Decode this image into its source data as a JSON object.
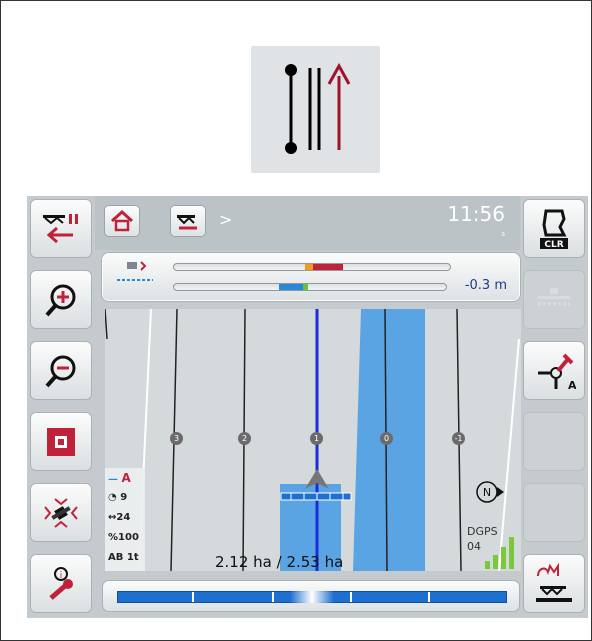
{
  "feature_icon": {
    "name": "parallel-tracks-icon"
  },
  "breadcrumb": {
    "separator": ">"
  },
  "status": {
    "time": "11:56",
    "time_sub": "s"
  },
  "left_buttons": [
    {
      "name": "pause-tracking-button",
      "icon": "implement-pause-icon"
    },
    {
      "name": "zoom-in-button",
      "icon": "zoom-in-icon"
    },
    {
      "name": "zoom-out-button",
      "icon": "zoom-out-icon"
    },
    {
      "name": "stop-button",
      "icon": "stop-square-icon"
    },
    {
      "name": "satellite-button",
      "icon": "satellite-icon"
    },
    {
      "name": "settings-button",
      "icon": "wrench-icon"
    }
  ],
  "right_buttons": [
    {
      "name": "clear-field-button",
      "icon": "clr-field-icon",
      "label": "CLR"
    },
    {
      "name": "boom-button",
      "icon": "boom-icon"
    },
    {
      "name": "set-point-a-button",
      "icon": "pin-a-icon",
      "label": "A"
    },
    {
      "name": "empty-button-1"
    },
    {
      "name": "empty-button-2"
    },
    {
      "name": "manual-section-button",
      "icon": "hand-implement-icon"
    }
  ],
  "lightbar": {
    "offset": "-0.3 m"
  },
  "info_panel": {
    "mode": "A",
    "speed": "9",
    "width": "24",
    "percent": "100",
    "ab": "AB",
    "ab_value": "1t"
  },
  "track_numbers": [
    "3",
    "2",
    "1",
    "0",
    "-1"
  ],
  "area": "2.12 ha / 2.53 ha",
  "gps": {
    "type": "DGPS",
    "sats": "04",
    "north": "N"
  },
  "colors": {
    "guidance_blue": "#1a2ed8",
    "worked_area": "#5ba4e4",
    "accent_red": "#c0223a"
  }
}
